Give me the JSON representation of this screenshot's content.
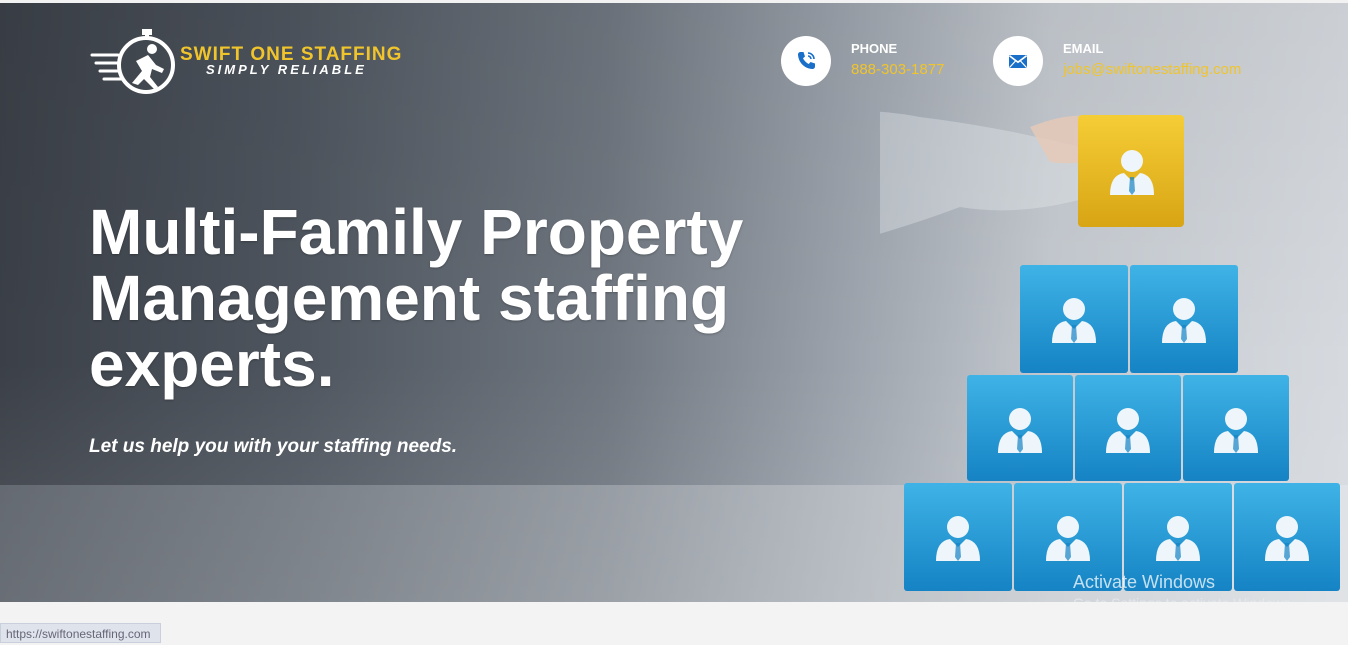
{
  "brand": {
    "name": "SWIFT ONE STAFFING",
    "tagline": "SIMPLY RELIABLE"
  },
  "contacts": {
    "phone": {
      "label": "PHONE",
      "value": "888-303-1877",
      "icon": "phone-icon"
    },
    "email": {
      "label": "EMAIL",
      "value": "jobs@swiftonestaffing.com",
      "icon": "envelope-icon"
    }
  },
  "hero": {
    "headline": "Multi-Family Property Management staffing experts.",
    "subheadline": "Let us help you with your staffing needs."
  },
  "watermark": {
    "title": "Activate Windows",
    "subtitle": "Go to Settings to activate Windows."
  },
  "statusbar": {
    "url": "https://swiftonestaffing.com"
  },
  "colors": {
    "accent": "#f0c42b",
    "icon_blue": "#1a6fc9",
    "cube_blue": "#1f9ad6",
    "cube_gold": "#e8b91c"
  }
}
